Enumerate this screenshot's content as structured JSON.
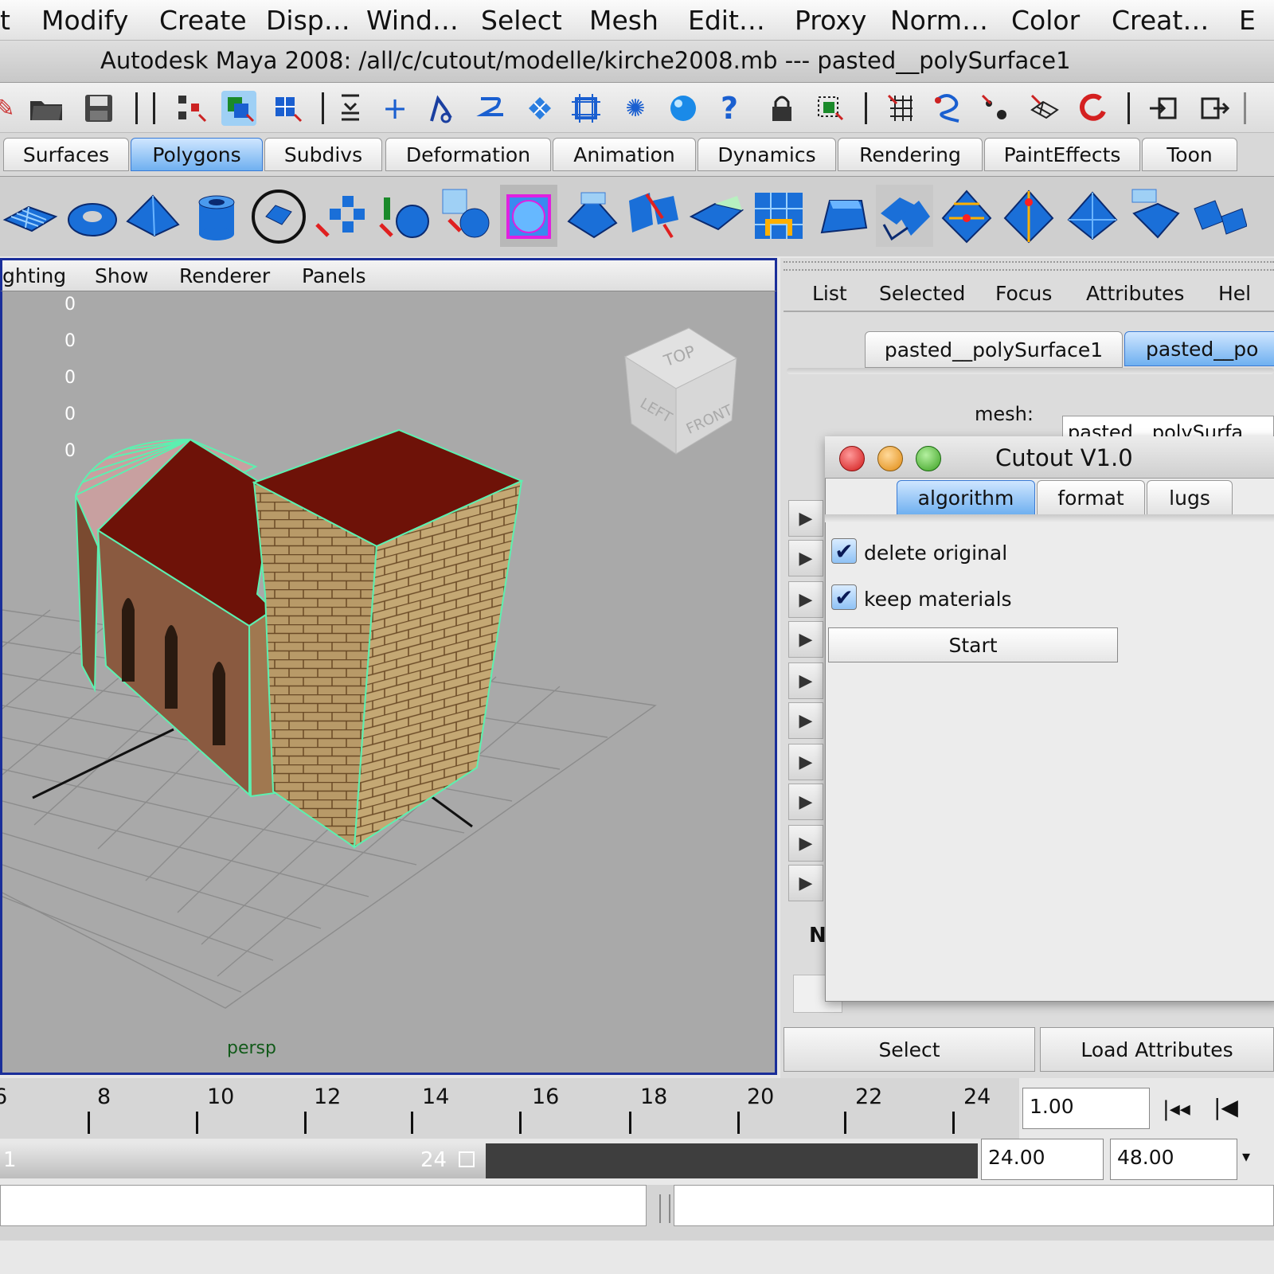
{
  "menubar": {
    "items": [
      "t",
      "Modify",
      "Create",
      "Disp…",
      "Wind…",
      "Select",
      "Mesh",
      "Edit…",
      "Proxy",
      "Norm…",
      "Color",
      "Creat…",
      "E"
    ]
  },
  "titlebar": {
    "title": "Autodesk Maya 2008:  /all/c/cutout/modelle/kirche2008.mb   ---    pasted__polySurface1"
  },
  "shelf_tabs": [
    "Surfaces",
    "Polygons",
    "Subdivs",
    "Deformation",
    "Animation",
    "Dynamics",
    "Rendering",
    "PaintEffects",
    "Toon"
  ],
  "viewport": {
    "menu": [
      "ghting",
      "Show",
      "Renderer",
      "Panels"
    ],
    "hud_values": [
      "0",
      "0",
      "0",
      "0",
      "0"
    ],
    "camera_label": "persp",
    "viewcube": {
      "top": "TOP",
      "left": "LEFT",
      "front": "FRONT"
    }
  },
  "channelbox": {
    "menu": [
      "List",
      "Selected",
      "Focus",
      "Attributes",
      "Hel"
    ],
    "tabs": [
      "pasted__polySurface1",
      "pasted__po"
    ],
    "mesh_label": "mesh:",
    "mesh_value": "pasted__polySurfa",
    "partial_label": "N"
  },
  "dialog": {
    "title": "Cutout V1.0",
    "tabs": [
      "algorithm",
      "format",
      "lugs"
    ],
    "checkboxes": [
      {
        "label": "delete original",
        "checked": true
      },
      {
        "label": "keep materials",
        "checked": true
      }
    ],
    "start_label": "Start"
  },
  "bottom_buttons": {
    "select": "Select",
    "load": "Load Attributes"
  },
  "timeline": {
    "ticks": [
      "6",
      "8",
      "10",
      "12",
      "14",
      "16",
      "18",
      "20",
      "22",
      "24"
    ],
    "current_time": "1.00",
    "range_start_label": "1",
    "range_end_label": "24",
    "range_end": "24.00",
    "anim_end": "48.00"
  },
  "colors": {
    "accent": "#3a7bd5",
    "viewport_border": "#1a2e9a",
    "wireframe": "#5cf0b0",
    "roof": "#6e1208",
    "brick": "#b89a68"
  }
}
